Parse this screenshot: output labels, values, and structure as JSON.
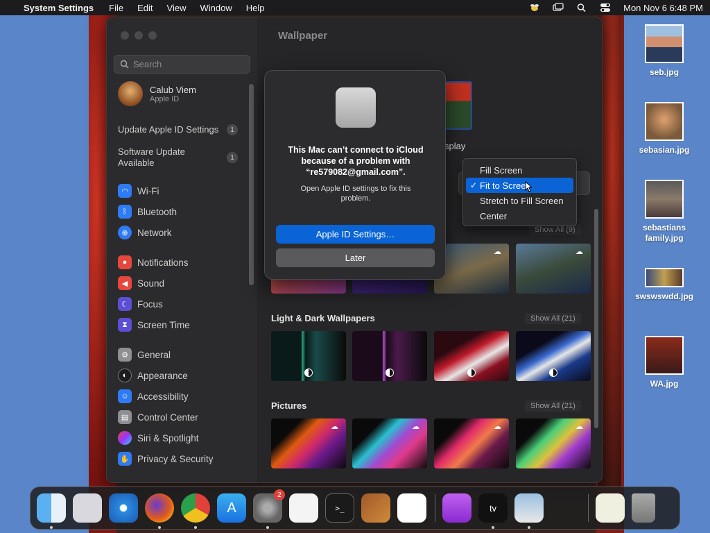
{
  "menubar": {
    "app_name": "System Settings",
    "menus": [
      "File",
      "Edit",
      "View",
      "Window",
      "Help"
    ],
    "clock": "Mon Nov 6  6:48 PM"
  },
  "sidebar": {
    "search_placeholder": "Search",
    "user_name": "Calub Viem",
    "user_sub": "Apple ID",
    "notices": [
      {
        "label": "Update Apple ID Settings",
        "count": "1"
      },
      {
        "label": "Software Update Available",
        "count": "1"
      }
    ],
    "group1": [
      {
        "label": "Wi-Fi",
        "icon": "wifi-icon",
        "color": "#2f7bf5"
      },
      {
        "label": "Bluetooth",
        "icon": "bluetooth-icon",
        "color": "#2f7bf5"
      },
      {
        "label": "Network",
        "icon": "globe-icon",
        "color": "#2f7bf5"
      }
    ],
    "group2": [
      {
        "label": "Notifications",
        "icon": "bell-icon",
        "color": "#e5473d"
      },
      {
        "label": "Sound",
        "icon": "speaker-icon",
        "color": "#e5473d"
      },
      {
        "label": "Focus",
        "icon": "moon-icon",
        "color": "#5c4fd6"
      },
      {
        "label": "Screen Time",
        "icon": "hourglass-icon",
        "color": "#5c4fd6"
      }
    ],
    "group3": [
      {
        "label": "General",
        "icon": "gear-icon",
        "color": "#8e8e93"
      },
      {
        "label": "Appearance",
        "icon": "appearance-icon",
        "color": "#1c1c1e"
      },
      {
        "label": "Accessibility",
        "icon": "accessibility-icon",
        "color": "#2f7bf5"
      },
      {
        "label": "Control Center",
        "icon": "control-center-icon",
        "color": "#8e8e93"
      },
      {
        "label": "Siri & Spotlight",
        "icon": "siri-icon",
        "color": "#b23fd0"
      },
      {
        "label": "Privacy & Security",
        "icon": "hand-icon",
        "color": "#2f7bf5"
      }
    ]
  },
  "content": {
    "title": "Wallpaper",
    "display_label": "splay",
    "sections": [
      {
        "title": "Light & Dark Wallpapers",
        "show_all": "Show All (21)"
      },
      {
        "title": "Pictures",
        "show_all": "Show All (21)"
      }
    ],
    "top_show_all": "Show All (9)"
  },
  "alert": {
    "title": "This Mac can’t connect to iCloud because of a problem with “re579082@gmail.com”.",
    "message": "Open Apple ID settings to fix this problem.",
    "primary": "Apple ID Settings…",
    "secondary": "Later"
  },
  "menu": {
    "options": [
      "Fill Screen",
      "Fit to Screen",
      "Stretch to Fill Screen",
      "Center"
    ],
    "selected": "Fit to Screen",
    "selected_label": "Fit to Scree"
  },
  "desktop_icons": [
    {
      "label": "seb.jpg"
    },
    {
      "label": "sebasian.jpg"
    },
    {
      "label": "sebastians family.jpg"
    },
    {
      "label": "swswswdd.jpg"
    },
    {
      "label": "WA.jpg"
    }
  ],
  "dock": {
    "settings_badge": "2",
    "apps": [
      "Finder",
      "Launchpad",
      "Safari",
      "Firefox",
      "Chrome",
      "App Store",
      "System Settings",
      "TextEdit",
      "Terminal",
      "GarageBand",
      "VS Code",
      "Podcasts",
      "Apple TV",
      "Preview",
      "Cyberduck",
      "Notes",
      "Trash"
    ],
    "tv_label": "tv"
  },
  "colors": {
    "accent": "#0a64d6",
    "badge": "#e0413a"
  }
}
